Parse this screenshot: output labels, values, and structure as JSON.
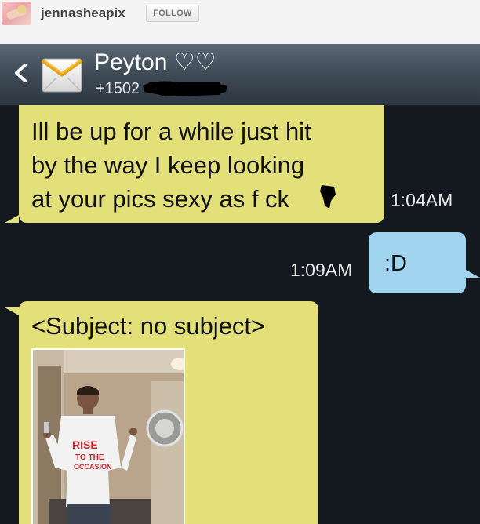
{
  "top_bar": {
    "username": "jennasheapix",
    "follow_label": "FOLLOW"
  },
  "header": {
    "contact_name": "Peyton ♡♡",
    "contact_number": "+1502"
  },
  "messages": [
    {
      "direction": "incoming",
      "text_lines": [
        "Ill be up for a while just hit",
        "by the way I keep looking",
        "at your pics sexy as f ck"
      ],
      "time": "1:04AM"
    },
    {
      "direction": "outgoing",
      "text": ":D",
      "time": "1:09AM"
    },
    {
      "direction": "incoming",
      "subject": "<Subject: no subject>",
      "has_photo": true
    }
  ],
  "colors": {
    "incoming_bubble": "#e3e07a",
    "outgoing_bubble": "#9fd3ee",
    "background": "#14191f"
  }
}
